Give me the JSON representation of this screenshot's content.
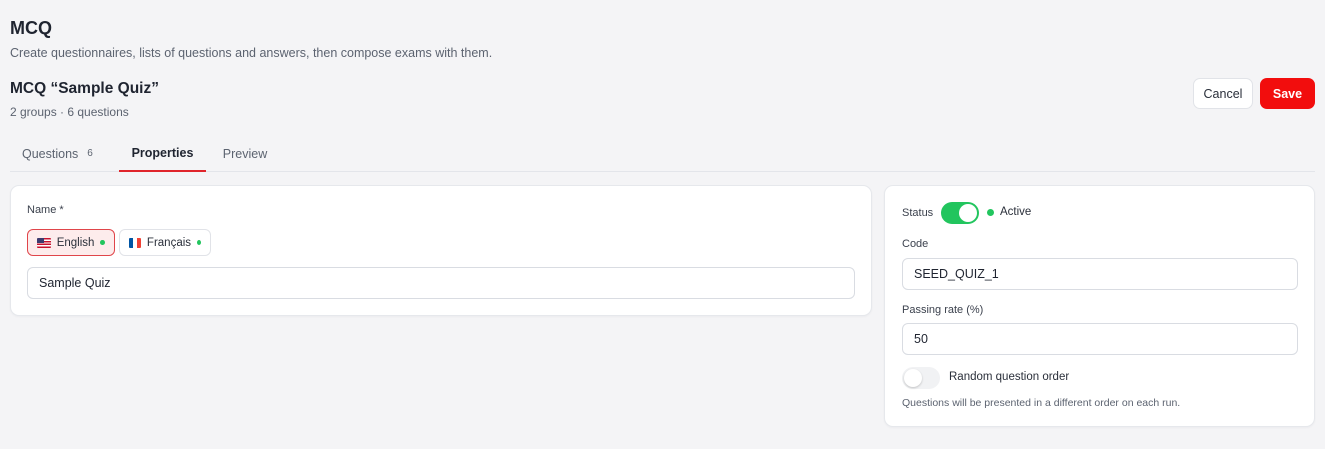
{
  "app": {
    "title": "MCQ",
    "description": "Create questionnaires, lists of questions and answers, then compose exams with them."
  },
  "quiz": {
    "title": "MCQ “Sample Quiz”",
    "meta": "2 groups · 6 questions"
  },
  "actions": {
    "cancel_label": "Cancel",
    "save_label": "Save"
  },
  "tabs": [
    {
      "label": "Questions",
      "count": "6",
      "active": false
    },
    {
      "label": "Properties",
      "active": true
    },
    {
      "label": "Preview",
      "active": false
    }
  ],
  "name_section": {
    "label": "Name *",
    "languages": [
      {
        "label": "English",
        "flag": "us-flag",
        "active": true
      },
      {
        "label": "Français",
        "flag": "fr-flag",
        "active": false
      }
    ],
    "value": "Sample Quiz"
  },
  "settings": {
    "status_label": "Status",
    "status_value": "Active",
    "status_enabled": true,
    "code_label": "Code",
    "code_value": "SEED_QUIZ_1",
    "passing_rate_label": "Passing rate (%)",
    "passing_rate_value": "50",
    "random_order_label": "Random question order",
    "random_order_enabled": false,
    "random_order_hint": "Questions will be presented in a different order on each run."
  },
  "colors": {
    "accent_red": "#f20d0d",
    "active_green": "#22c55e",
    "tab_underline": "#e0252b",
    "page_background": "#f4f4f6"
  }
}
